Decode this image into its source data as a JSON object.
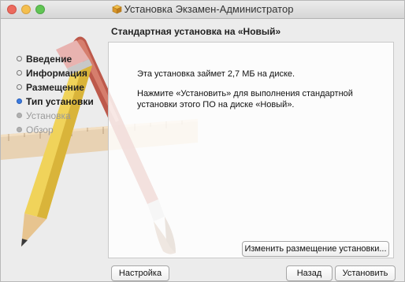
{
  "window": {
    "title": "Установка Экзамен-Администратор",
    "icon": "installer-box-icon"
  },
  "heading": "Стандартная установка на «Новый»",
  "sidebar": {
    "items": [
      {
        "label": "Введение",
        "state": "done"
      },
      {
        "label": "Информация",
        "state": "done"
      },
      {
        "label": "Размещение",
        "state": "done"
      },
      {
        "label": "Тип установки",
        "state": "current"
      },
      {
        "label": "Установка",
        "state": "future"
      },
      {
        "label": "Обзор",
        "state": "future"
      }
    ]
  },
  "content": {
    "line1": "Эта установка займет 2,7 МБ на диске.",
    "line2": "Нажмите «Установить» для выполнения стандартной установки этого ПО на диске «Новый»."
  },
  "buttons": {
    "change_location": "Изменить размещение установки...",
    "customize": "Настройка",
    "back": "Назад",
    "install": "Установить"
  },
  "colors": {
    "current_step": "#3b7be0",
    "window_bg": "#ececec"
  }
}
